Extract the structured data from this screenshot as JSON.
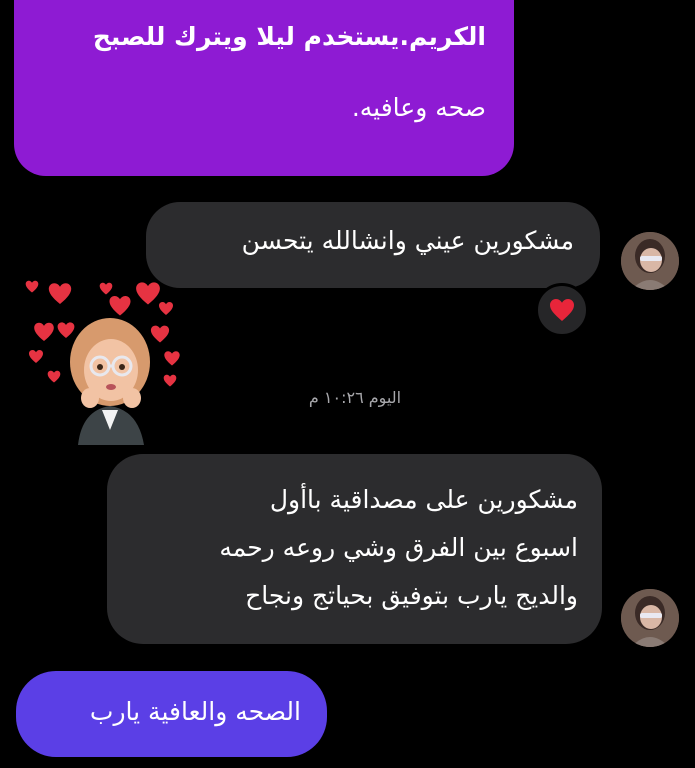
{
  "messages": {
    "sent_top": {
      "line1": "الكريم.يستخدم ليلا  ويترك للصبح",
      "line2": "صحه وعافيه."
    },
    "received_1": {
      "text": "مشكورين عيني وانشالله يتحسن",
      "reaction": "heart"
    },
    "timestamp": "اليوم ١٠:٢٦ م",
    "received_2": {
      "line1": "مشكورين على مصداقية باأول",
      "line2": "اسبوع بين الفرق وشي روعه رحمه",
      "line3": "والديج يارب بتوفيق بحياتج ونجاح"
    },
    "sent_bottom": {
      "text": "الصحه والعافية يارب"
    }
  },
  "colors": {
    "background": "#000000",
    "sent_purple": "#8e1bd3",
    "sent_indigo": "#5b3fe6",
    "received_gray": "#2c2c2e",
    "timestamp_gray": "#a7a7ab",
    "heart_red": "#e8253a"
  },
  "icons": {
    "reaction": "heart-icon",
    "avatar": "avatar-photo",
    "sticker": "hearts-avatar-sticker"
  }
}
